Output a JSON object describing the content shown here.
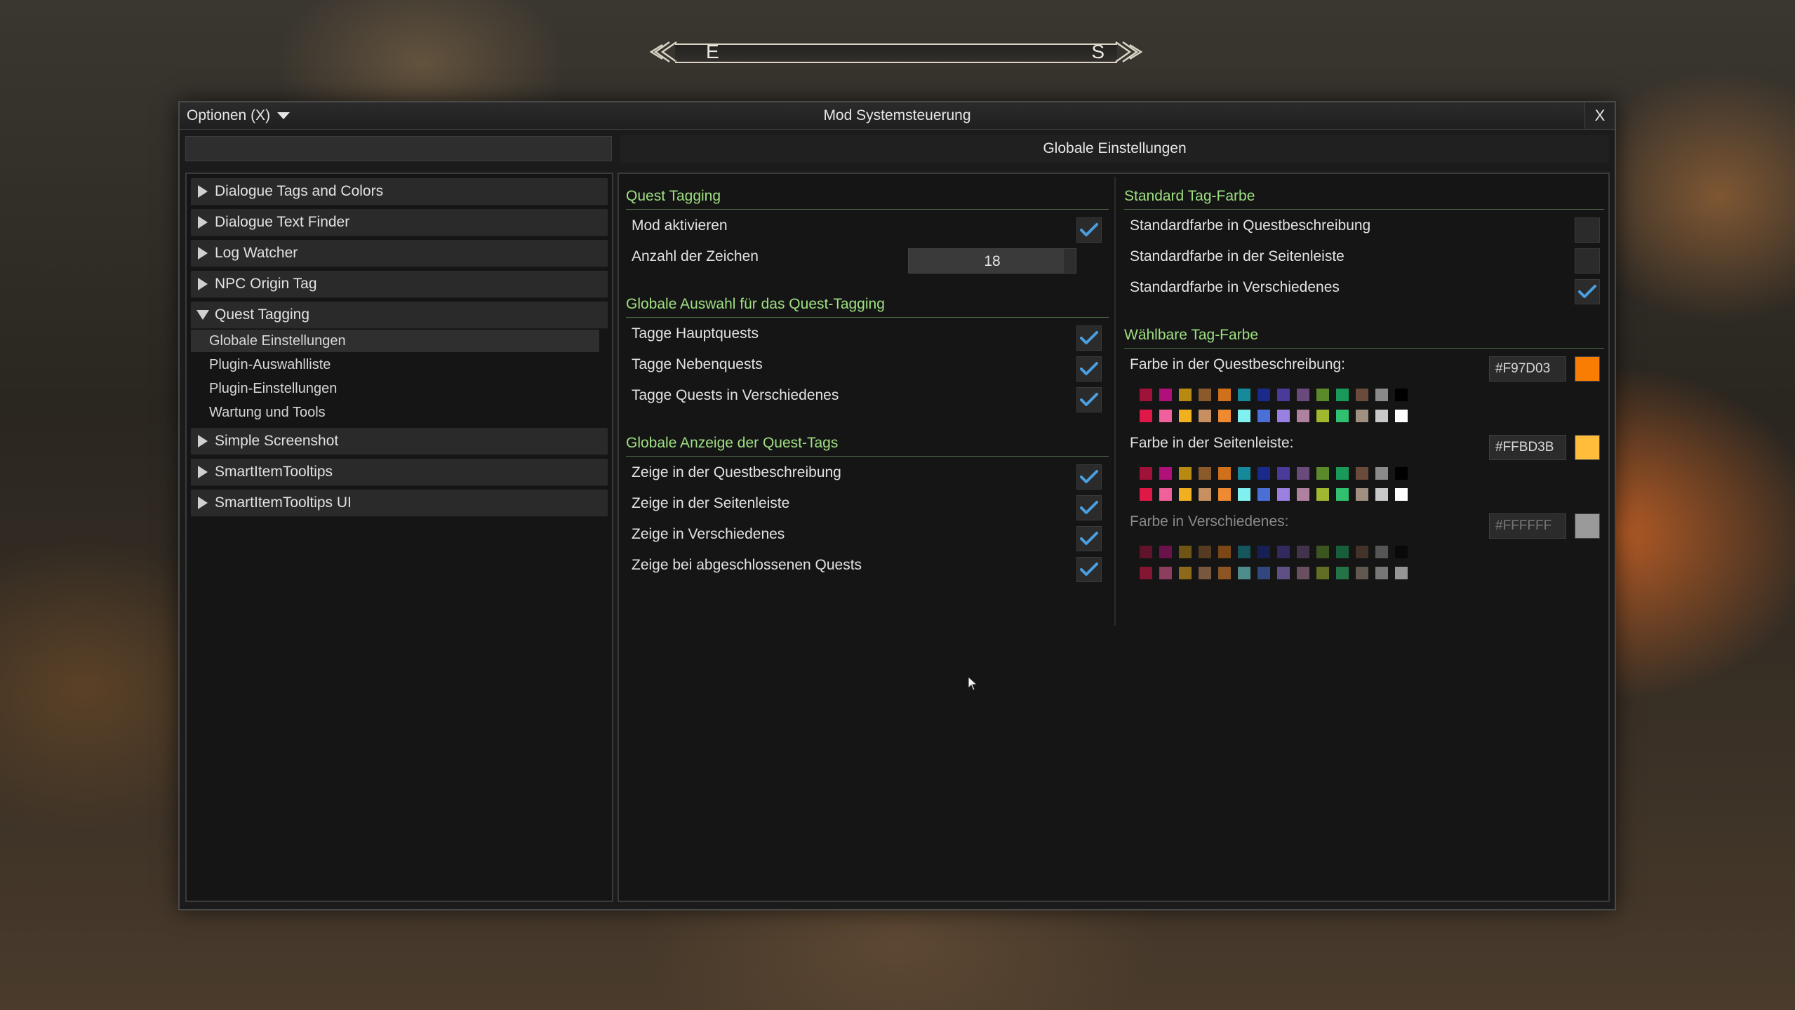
{
  "compass": {
    "left": "E",
    "right": "S"
  },
  "window": {
    "options_label": "Optionen (X)",
    "title": "Mod Systemsteuerung",
    "close_label": "X",
    "page_header": "Globale Einstellungen"
  },
  "sidebar": {
    "items": [
      {
        "label": "Dialogue Tags and Colors"
      },
      {
        "label": "Dialogue Text Finder"
      },
      {
        "label": "Log Watcher"
      },
      {
        "label": "NPC Origin Tag"
      },
      {
        "label": "Quest Tagging"
      },
      {
        "label": "Simple Screenshot"
      },
      {
        "label": "SmartItemTooltips"
      },
      {
        "label": "SmartItemTooltips UI"
      }
    ],
    "subitems": [
      {
        "label": "Globale Einstellungen"
      },
      {
        "label": "Plugin-Auswahlliste"
      },
      {
        "label": "Plugin-Einstellungen"
      },
      {
        "label": "Wartung und Tools"
      }
    ]
  },
  "left_col": {
    "sec1": "Quest Tagging",
    "mod_aktivieren": "Mod aktivieren",
    "anzahl_zeichen": "Anzahl der Zeichen",
    "anzahl_value": "18",
    "anzahl_fraction": 0.93,
    "sec2": "Globale Auswahl für das Quest-Tagging",
    "tagge_haupt": "Tagge Hauptquests",
    "tagge_neben": "Tagge Nebenquests",
    "tagge_versch": "Tagge Quests in Verschiedenes",
    "sec3": "Globale Anzeige der Quest-Tags",
    "zeige_beschreibung": "Zeige in der Questbeschreibung",
    "zeige_seitenleiste": "Zeige in der Seitenleiste",
    "zeige_versch": "Zeige in Verschiedenes",
    "zeige_abgeschlossen": "Zeige bei abgeschlossenen Quests"
  },
  "right_col": {
    "sec1": "Standard Tag-Farbe",
    "std_beschreibung": "Standardfarbe in Questbeschreibung",
    "std_seitenleiste": "Standardfarbe in der Seitenleiste",
    "std_versch": "Standardfarbe in Verschiedenes",
    "sec2": "Wählbare Tag-Farbe",
    "farbe_beschreibung": "Farbe in der Questbeschreibung:",
    "hex_beschreibung": "#F97D03",
    "farbe_seitenleiste": "Farbe in der Seitenleiste:",
    "hex_seitenleiste": "#FFBD3B",
    "farbe_versch": "Farbe in Verschiedenes:",
    "hex_versch": "#FFFFFF"
  },
  "colors": {
    "accent_green": "#9fe082",
    "check_blue": "#4a9fe0",
    "swatch_beschreibung": "#F97D03",
    "swatch_seitenleiste": "#FFBD3B",
    "swatch_versch": "#9a9a9a",
    "palette_row1": [
      "#a0123a",
      "#b0107a",
      "#b88a12",
      "#8a5a2a",
      "#d0701a",
      "#168a9a",
      "#1a2a8a",
      "#4a3a9a",
      "#6a4a7a",
      "#5a8a2a",
      "#1a9a5a",
      "#6a4a3a",
      "#8a8a8a",
      "#000000"
    ],
    "palette_row2": [
      "#e01848",
      "#f0609a",
      "#f0b020",
      "#c89060",
      "#f08a30",
      "#80f0f0",
      "#4a70d8",
      "#9a80e0",
      "#b080a0",
      "#a0b830",
      "#30c070",
      "#a09080",
      "#c8c8c8",
      "#ffffff"
    ]
  },
  "checkboxes": {
    "mod_aktivieren": true,
    "tagge_haupt": true,
    "tagge_neben": true,
    "tagge_versch": true,
    "zeige_beschreibung": true,
    "zeige_seitenleiste": true,
    "zeige_versch": true,
    "zeige_abgeschlossen": true,
    "std_beschreibung": false,
    "std_seitenleiste": false,
    "std_versch": true
  }
}
